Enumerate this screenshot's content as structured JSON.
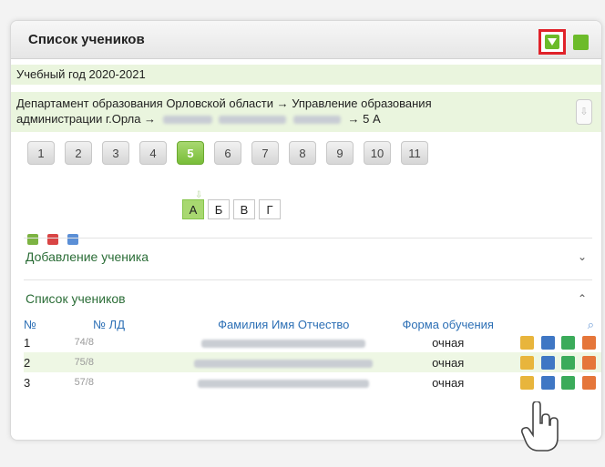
{
  "panel": {
    "title": "Список учеников"
  },
  "year": "Учебный год 2020-2021",
  "path": {
    "line1": "Департамент образования Орловской области → Управление образования",
    "line2_prefix": "администрации г.Орла →",
    "line2_suffix": "→ 5 А"
  },
  "grades": [
    "1",
    "2",
    "3",
    "4",
    "5",
    "6",
    "7",
    "8",
    "9",
    "10",
    "11"
  ],
  "letters": [
    "А",
    "Б",
    "В",
    "Г"
  ],
  "sections": {
    "add": "Добавление ученика",
    "list": "Список учеников"
  },
  "table": {
    "headers": {
      "num": "№",
      "ld": "№ ЛД",
      "name": "Фамилия Имя Отчество",
      "form": "Форма обучения"
    },
    "rows": [
      {
        "num": "1",
        "ld": "74/8",
        "form": "очная"
      },
      {
        "num": "2",
        "ld": "75/8",
        "form": "очная"
      },
      {
        "num": "3",
        "ld": "57/8",
        "form": "очная"
      }
    ]
  },
  "colors": {
    "accent_green": "#6cbb2a",
    "active_grade": "#a8d870",
    "link_blue": "#2c6fb5",
    "highlight_red": "#e0222a"
  }
}
